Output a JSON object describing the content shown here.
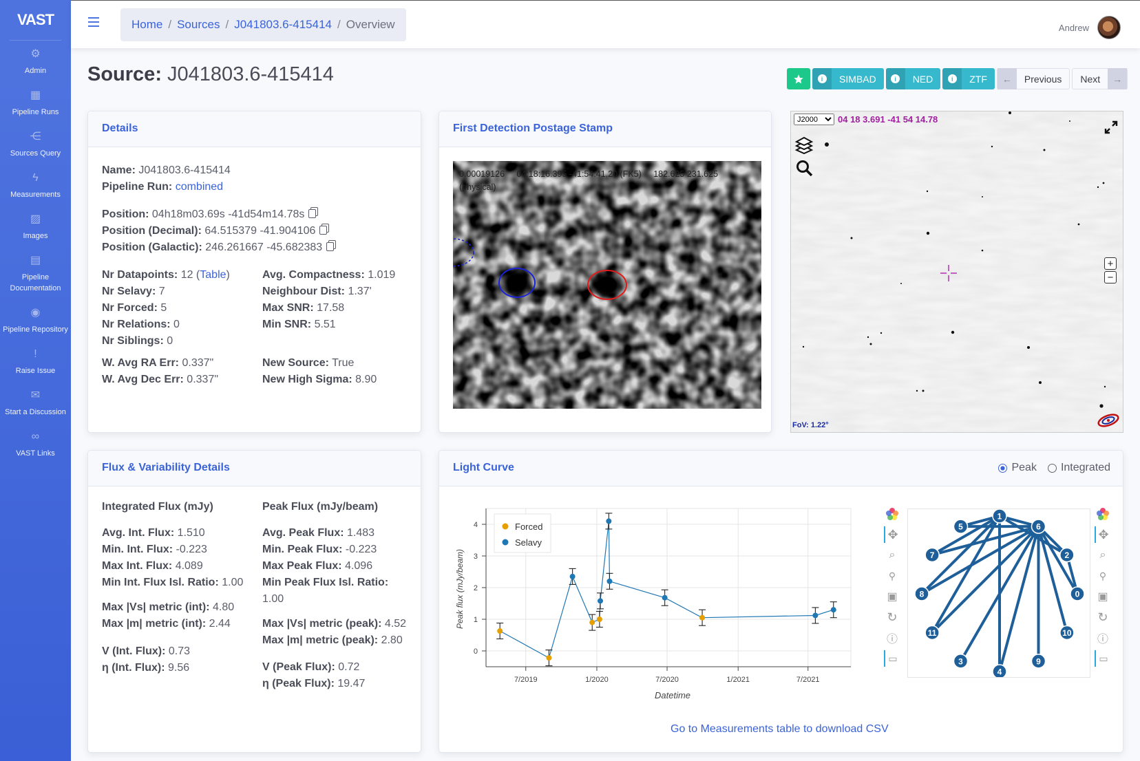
{
  "sidebar": {
    "brand": "VAST",
    "items": [
      {
        "label": "Admin",
        "icon": "gear-icon"
      },
      {
        "label": "Pipeline Runs",
        "icon": "table-icon"
      },
      {
        "label": "Sources Query",
        "icon": "share-icon"
      },
      {
        "label": "Measurements",
        "icon": "bolt-icon"
      },
      {
        "label": "Images",
        "icon": "images-icon"
      },
      {
        "label": "Pipeline Documentation",
        "icon": "file-icon"
      },
      {
        "label": "Pipeline Repository",
        "icon": "github-icon"
      },
      {
        "label": "Raise Issue",
        "icon": "exclamation-icon"
      },
      {
        "label": "Start a Discussion",
        "icon": "comments-icon"
      },
      {
        "label": "VAST Links",
        "icon": "link-icon"
      }
    ]
  },
  "breadcrumb": {
    "home": "Home",
    "sources": "Sources",
    "source": "J041803.6-415414",
    "current": "Overview"
  },
  "user": {
    "name": "Andrew"
  },
  "page": {
    "title_prefix": "Source:",
    "title_name": "J041803.6-415414"
  },
  "actions": {
    "simbad": "SIMBAD",
    "ned": "NED",
    "ztf": "ZTF",
    "previous": "Previous",
    "next": "Next"
  },
  "details": {
    "header": "Details",
    "name_label": "Name:",
    "name": "J041803.6-415414",
    "run_label": "Pipeline Run:",
    "run": "combined",
    "pos_label": "Position:",
    "pos": "04h18m03.69s -41d54m14.78s",
    "posdec_label": "Position (Decimal):",
    "posdec": "64.515379 -41.904106",
    "posgal_label": "Position (Galactic):",
    "posgal": "246.261667 -45.682383",
    "left": [
      {
        "k": "Nr Datapoints:",
        "v": "12"
      },
      {
        "k": "Nr Selavy:",
        "v": "7"
      },
      {
        "k": "Nr Forced:",
        "v": "5"
      },
      {
        "k": "Nr Relations:",
        "v": "0"
      },
      {
        "k": "Nr Siblings:",
        "v": "0"
      }
    ],
    "table_link": "Table",
    "right": [
      {
        "k": "Avg. Compactness:",
        "v": "1.019"
      },
      {
        "k": "Neighbour Dist:",
        "v": "1.37'"
      },
      {
        "k": "Max SNR:",
        "v": "17.58"
      },
      {
        "k": "Min SNR:",
        "v": "5.51"
      }
    ],
    "bottom_left": [
      {
        "k": "W. Avg RA Err:",
        "v": "0.337\""
      },
      {
        "k": "W. Avg Dec Err:",
        "v": "0.337\""
      }
    ],
    "bottom_right": [
      {
        "k": "New Source:",
        "v": "True"
      },
      {
        "k": "New High Sigma:",
        "v": "8.90"
      }
    ]
  },
  "stamp": {
    "header": "First Detection Postage Stamp",
    "value": "0.00019126",
    "coords": "04:18:16.395 -41:54:41.20 (FK5)",
    "pixel": "182.625 231.625",
    "frame": "(physical)"
  },
  "aladin": {
    "frame": "J2000",
    "coord": "04 18 3.691 -41 54 14.78",
    "fov": "FoV: 1.22°"
  },
  "flux": {
    "header": "Flux & Variability Details",
    "int_title": "Integrated Flux (mJy)",
    "peak_title": "Peak Flux (mJy/beam)",
    "int": [
      {
        "k": "Avg. Int. Flux:",
        "v": "1.510"
      },
      {
        "k": "Min. Int. Flux:",
        "v": "-0.223"
      },
      {
        "k": "Max Int. Flux:",
        "v": "4.089"
      },
      {
        "k": "Min Int. Flux Isl. Ratio:",
        "v": "1.00"
      }
    ],
    "int_metrics": [
      {
        "k": "Max |Vs| metric (int):",
        "v": "4.80"
      },
      {
        "k": "Max |m| metric (int):",
        "v": "2.44"
      }
    ],
    "int_var": [
      {
        "k": "V (Int. Flux):",
        "v": "0.73"
      },
      {
        "k": "η (Int. Flux):",
        "v": "9.56"
      }
    ],
    "peak": [
      {
        "k": "Avg. Peak Flux:",
        "v": "1.483"
      },
      {
        "k": "Min. Peak Flux:",
        "v": "-0.223"
      },
      {
        "k": "Max Peak Flux:",
        "v": "4.096"
      },
      {
        "k": "Min Peak Flux Isl. Ratio:",
        "v": "1.00"
      }
    ],
    "peak_metrics": [
      {
        "k": "Max |Vs| metric (peak):",
        "v": "4.52"
      },
      {
        "k": "Max |m| metric (peak):",
        "v": "2.80"
      }
    ],
    "peak_var": [
      {
        "k": "V (Peak Flux):",
        "v": "0.72"
      },
      {
        "k": "η (Peak Flux):",
        "v": "19.47"
      }
    ]
  },
  "lightcurve": {
    "header": "Light Curve",
    "radio_peak": "Peak",
    "radio_int": "Integrated",
    "csv_link": "Go to Measurements table to download CSV"
  },
  "chart_data": [
    {
      "type": "scatter",
      "xlabel": "Datetime",
      "ylabel": "Peak flux (mJy/beam)",
      "ylim": [
        -0.5,
        4.5
      ],
      "xlim": [
        "2019-03-20",
        "2021-10-20"
      ],
      "x_ticks": [
        "7/2019",
        "1/2020",
        "7/2020",
        "1/2021",
        "7/2021"
      ],
      "y_ticks": [
        "0",
        "1",
        "2",
        "3",
        "4"
      ],
      "grid": true,
      "legend_position": "top-left",
      "colors": {
        "Forced": "#e69f00",
        "Selavy": "#1f77b4"
      },
      "points": [
        {
          "x": "2019-04-25",
          "y": 0.63,
          "err": 0.25,
          "type": "Forced"
        },
        {
          "x": "2019-08-30",
          "y": -0.22,
          "err": 0.25,
          "type": "Forced"
        },
        {
          "x": "2019-10-30",
          "y": 2.35,
          "err": 0.25,
          "type": "Selavy"
        },
        {
          "x": "2019-12-20",
          "y": 0.9,
          "err": 0.25,
          "type": "Forced"
        },
        {
          "x": "2020-01-08",
          "y": 1.0,
          "err": 0.25,
          "type": "Forced"
        },
        {
          "x": "2020-01-10",
          "y": 1.58,
          "err": 0.25,
          "type": "Selavy"
        },
        {
          "x": "2020-02-01",
          "y": 4.1,
          "err": 0.25,
          "type": "Selavy"
        },
        {
          "x": "2020-02-03",
          "y": 2.2,
          "err": 0.25,
          "type": "Selavy"
        },
        {
          "x": "2020-06-25",
          "y": 1.68,
          "err": 0.25,
          "type": "Selavy"
        },
        {
          "x": "2020-09-30",
          "y": 1.05,
          "err": 0.25,
          "type": "Forced"
        },
        {
          "x": "2021-07-20",
          "y": 1.12,
          "err": 0.25,
          "type": "Selavy"
        },
        {
          "x": "2021-09-05",
          "y": 1.3,
          "err": 0.25,
          "type": "Selavy"
        }
      ]
    },
    {
      "type": "graph",
      "nodes": [
        "0",
        "1",
        "2",
        "3",
        "4",
        "5",
        "6",
        "7",
        "8",
        "9",
        "10",
        "11"
      ],
      "edges": [
        [
          "1",
          "5"
        ],
        [
          "1",
          "7"
        ],
        [
          "1",
          "8"
        ],
        [
          "1",
          "11"
        ],
        [
          "1",
          "6"
        ],
        [
          "1",
          "2"
        ],
        [
          "1",
          "4"
        ],
        [
          "6",
          "7"
        ],
        [
          "6",
          "8"
        ],
        [
          "6",
          "11"
        ],
        [
          "6",
          "3"
        ],
        [
          "6",
          "4"
        ],
        [
          "6",
          "9"
        ],
        [
          "6",
          "10"
        ],
        [
          "6",
          "0"
        ],
        [
          "6",
          "2"
        ],
        [
          "6",
          "5"
        ],
        [
          "2",
          "0"
        ]
      ],
      "color": "#1f5f99"
    }
  ]
}
